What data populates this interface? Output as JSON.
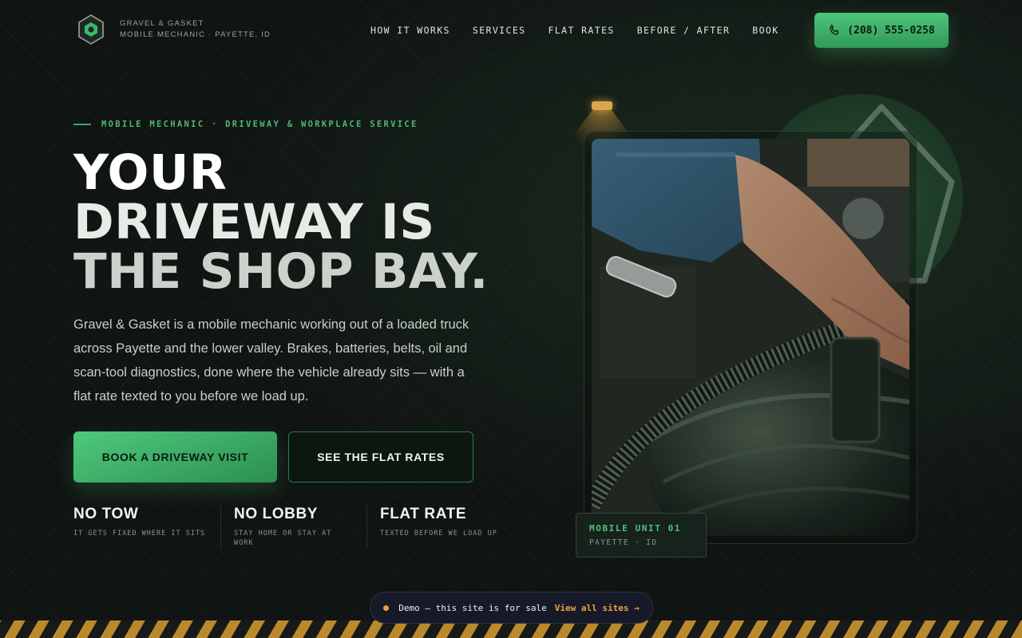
{
  "brand": {
    "name_line1": "Gravel & Gasket",
    "name_line2": "Mobile Mechanic · Payette, ID",
    "logo_icon": "hex-nut-icon"
  },
  "nav": {
    "items": [
      "How It Works",
      "Services",
      "Flat Rates",
      "Before / After",
      "Book"
    ],
    "phone": "(208) 555-0258"
  },
  "hero": {
    "eyebrow": "Mobile Mechanic · Driveway & Workplace Service",
    "headline_lines": [
      "YOUR",
      "DRIVEWAY IS",
      "THE SHOP BAY."
    ],
    "intro": "Gravel & Gasket is a mobile mechanic working out of a loaded truck across Payette and the lower valley. Brakes, batteries, belts, oil and scan-tool diagnostics, done where the vehicle already sits — with a flat rate texted to you before we load up.",
    "cta_primary": "Book a Driveway Visit",
    "cta_secondary": "See the Flat Rates",
    "features": [
      {
        "title": "No Tow",
        "subtitle": "It gets fixed where it sits"
      },
      {
        "title": "No Lobby",
        "subtitle": "Stay home or stay at work"
      },
      {
        "title": "Flat Rate",
        "subtitle": "Texted before we load up"
      }
    ]
  },
  "unit_badge": {
    "title": "Mobile Unit 01",
    "location": "Payette · ID"
  },
  "demo_banner": {
    "text": "Demo — this site is for sale",
    "link": "View all sites →"
  },
  "colors": {
    "accent": "#4fb873",
    "background": "#101412",
    "warning": "#f0a040"
  }
}
